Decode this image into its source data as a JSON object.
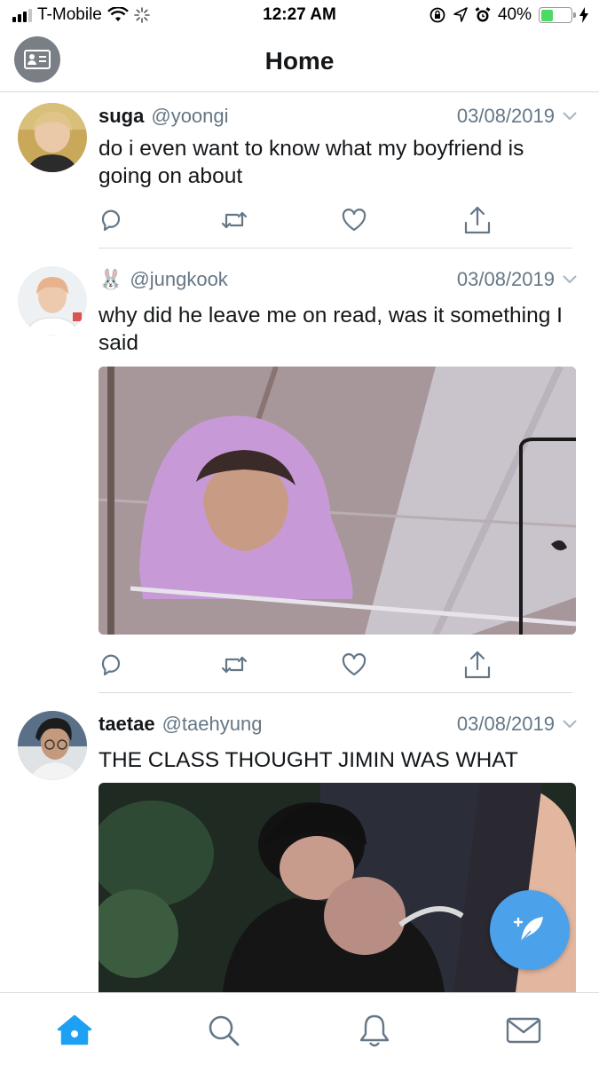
{
  "status_bar": {
    "carrier": "T-Mobile",
    "time": "12:27 AM",
    "battery": "40%",
    "battery_level": 0.4
  },
  "header": {
    "title": "Home"
  },
  "tweets": [
    {
      "name": "suga",
      "handle": "@yoongi",
      "date": "03/08/2019",
      "text": "do i even want to know what my boyfriend is going on about"
    },
    {
      "name": "🐰",
      "handle": "@jungkook",
      "date": "03/08/2019",
      "text": "why did he leave me on read, was it something I said"
    },
    {
      "name": "taetae",
      "handle": "@taehyung",
      "date": "03/08/2019",
      "text": "THE CLASS THOUGHT JIMIN WAS WHAT"
    }
  ],
  "icons": {
    "reply": "speech-bubble-icon",
    "retweet": "retweet-icon",
    "like": "heart-icon",
    "share": "share-icon",
    "compose": "compose-feather-icon",
    "home": "home-icon",
    "search": "search-icon",
    "notifications": "bell-icon",
    "messages": "mail-icon"
  },
  "colors": {
    "accent": "#1da1f2",
    "fab": "#4ba1ea",
    "secondary_text": "#657786",
    "battery": "#4cd964"
  }
}
